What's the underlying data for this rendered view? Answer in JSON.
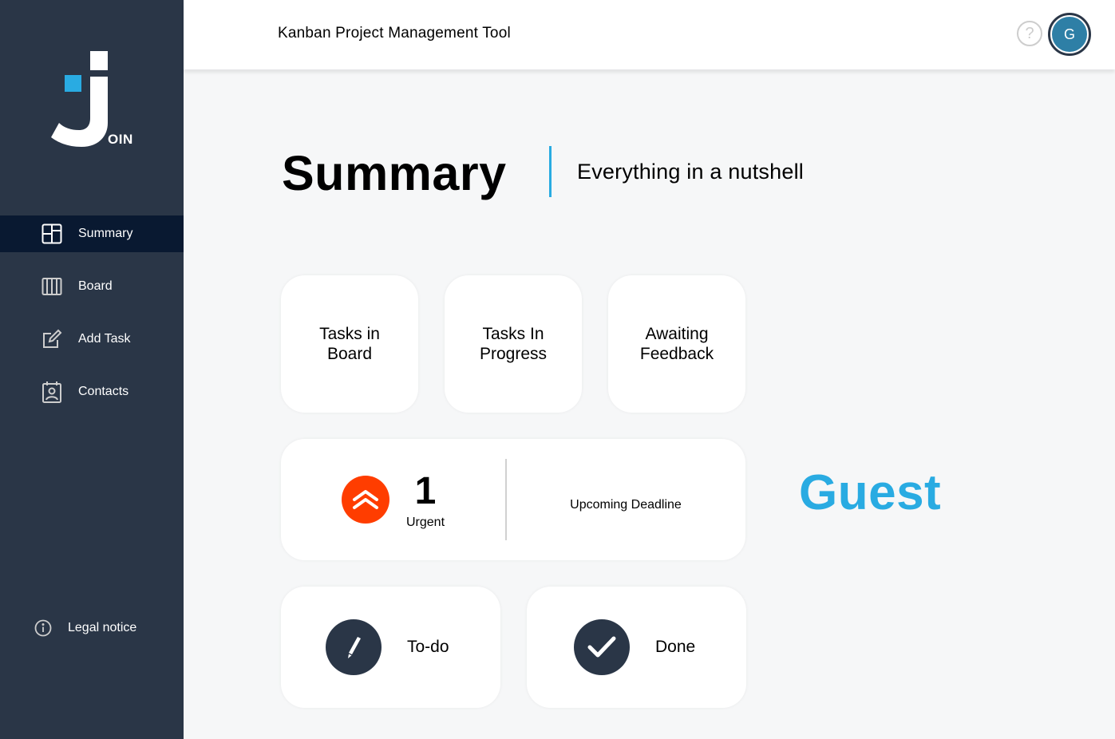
{
  "app": {
    "logo_text": "OIN",
    "header_title": "Kanban Project Management Tool",
    "help_label": "?",
    "user_initial": "G"
  },
  "sidebar": {
    "items": [
      {
        "label": "Summary",
        "icon": "summary-icon",
        "active": true
      },
      {
        "label": "Board",
        "icon": "board-icon",
        "active": false
      },
      {
        "label": "Add Task",
        "icon": "add-task-icon",
        "active": false
      },
      {
        "label": "Contacts",
        "icon": "contacts-icon",
        "active": false
      }
    ],
    "legal_label": "Legal notice"
  },
  "summary": {
    "title": "Summary",
    "subtitle": "Everything in a nutshell",
    "cards": [
      {
        "label": "Tasks in Board"
      },
      {
        "label": "Tasks In Progress"
      },
      {
        "label": "Awaiting Feedback"
      }
    ],
    "urgent": {
      "count": "1",
      "label": "Urgent"
    },
    "deadline_label": "Upcoming Deadline",
    "todo_label": "To-do",
    "done_label": "Done",
    "greeting_name": "Guest"
  },
  "colors": {
    "sidebar_bg": "#2a3647",
    "active_nav_bg": "#091931",
    "accent": "#29abe2",
    "urgent": "#ff3d00",
    "page_bg": "#f6f7f8"
  }
}
